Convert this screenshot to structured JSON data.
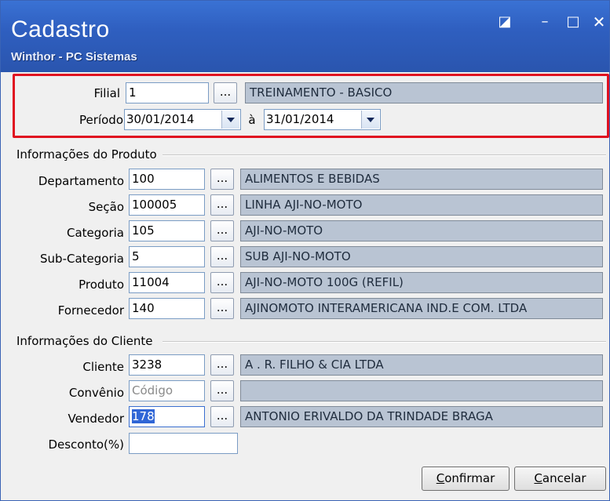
{
  "window": {
    "title": "Cadastro",
    "subtitle": "Winthor - PC Sistemas",
    "controls": {
      "restore": "◪",
      "minimize": "–",
      "maximize": "□",
      "close": "✕"
    }
  },
  "filter": {
    "filial": {
      "label": "Filial",
      "value": "1",
      "description": "TREINAMENTO - BASICO"
    },
    "periodo": {
      "label": "Período",
      "from": "30/01/2014",
      "separator": "à",
      "to": "31/01/2014"
    }
  },
  "produto": {
    "group_title": "Informações do Produto",
    "rows": [
      {
        "label": "Departamento",
        "value": "100",
        "description": "ALIMENTOS E BEBIDAS"
      },
      {
        "label": "Seção",
        "value": "100005",
        "description": "LINHA AJI-NO-MOTO"
      },
      {
        "label": "Categoria",
        "value": "105",
        "description": "AJI-NO-MOTO"
      },
      {
        "label": "Sub-Categoria",
        "value": "5",
        "description": "SUB AJI-NO-MOTO"
      },
      {
        "label": "Produto",
        "value": "11004",
        "description": "AJI-NO-MOTO 100G (REFIL)"
      },
      {
        "label": "Fornecedor",
        "value": "140",
        "description": "AJINOMOTO INTERAMERICANA IND.E COM. LTDA"
      }
    ]
  },
  "cliente": {
    "group_title": "Informações do Cliente",
    "rows": [
      {
        "label": "Cliente",
        "value": "3238",
        "description": "A . R.  FILHO & CIA LTDA"
      },
      {
        "label": "Convênio",
        "placeholder": "Código",
        "description": ""
      },
      {
        "label": "Vendedor",
        "value": "178",
        "description": "ANTONIO ERIVALDO DA TRINDADE BRAGA"
      }
    ],
    "desconto": {
      "label": "Desconto(%)",
      "value": ""
    }
  },
  "buttons": {
    "ellipsis": "...",
    "confirmar": {
      "accel": "C",
      "rest": "onfirmar"
    },
    "cancelar": {
      "accel": "C",
      "rest": "ancelar"
    }
  }
}
